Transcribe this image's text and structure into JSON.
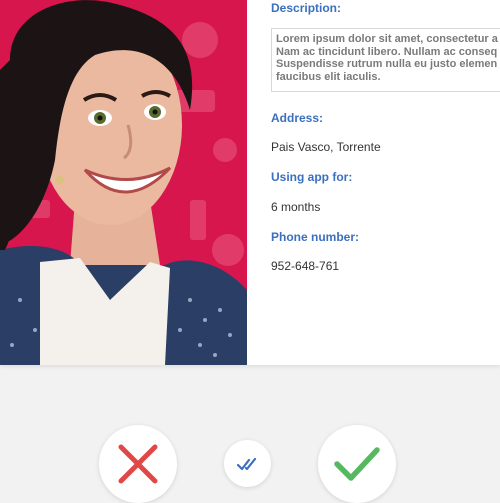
{
  "profile": {
    "description_label": "Description:",
    "description_lines": [
      "Lorem ipsum dolor sit amet, consectetur a",
      "Nam ac tincidunt libero. Nullam ac conseq",
      "Suspendisse rutrum nulla eu justo elemen",
      "faucibus elit iaculis."
    ],
    "address_label": "Address:",
    "address_value": "Pais Vasco, Torrente",
    "using_label": "Using app for:",
    "using_value": "6 months",
    "phone_label": "Phone number:",
    "phone_value": "952-648-761"
  },
  "actions": {
    "reject_icon": "close-icon",
    "super_icon": "double-check-icon",
    "accept_icon": "check-icon"
  },
  "colors": {
    "label": "#3b6fbf",
    "reject": "#e04848",
    "accept": "#58b860",
    "super": "#3b6fbf",
    "photo_background": "#d8164e"
  }
}
